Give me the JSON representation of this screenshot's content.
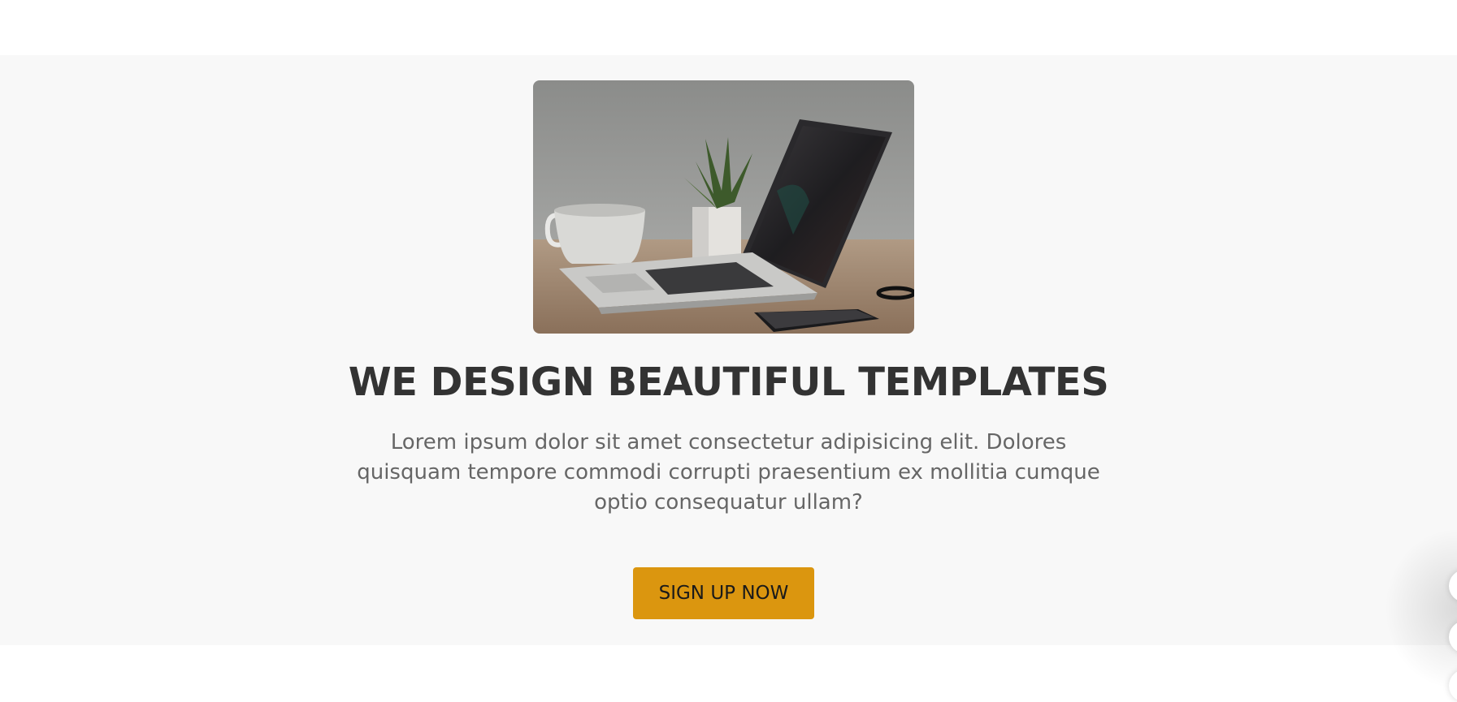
{
  "hero": {
    "image_alt": "Laptop, coffee cup, plant and phone on a desk",
    "headline": "WE DESIGN BEAUTIFUL TEMPLATES",
    "description": "Lorem ipsum dolor sit amet consectetur adipisicing elit. Dolores quisquam tempore commodi corrupti praesentium ex mollitia cumque optio consequatur ullam?",
    "cta_label": "SIGN UP NOW"
  },
  "colors": {
    "section_background": "#f8f8f8",
    "cta_background": "#db960f",
    "headline_text": "#333333",
    "body_text": "#666666"
  }
}
